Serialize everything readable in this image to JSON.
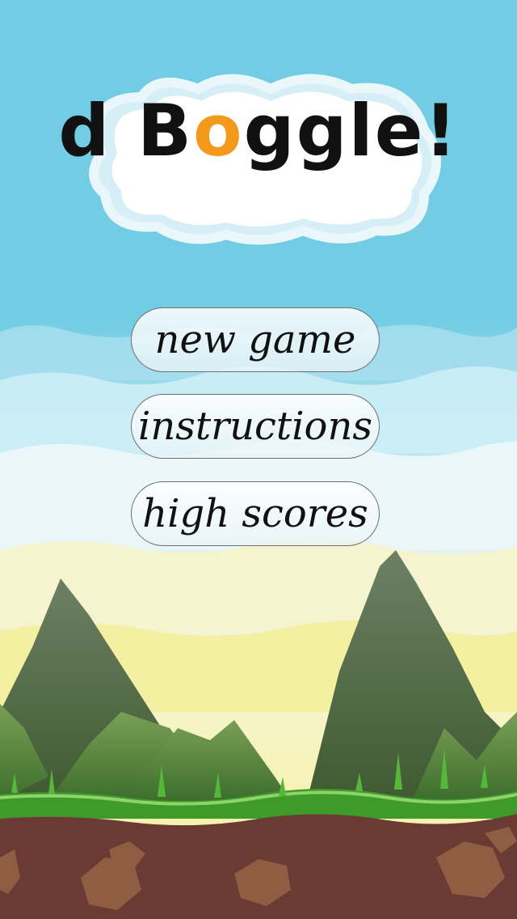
{
  "app": {
    "title_parts": [
      "d B",
      "o",
      "ggle!"
    ]
  },
  "menu": {
    "new_game": "new game",
    "instructions": "instructions",
    "high_scores": "high scores"
  },
  "colors": {
    "sky_top": "#72cde4",
    "sky_bottom": "#fbf4c8",
    "mountain": "#596d50",
    "grass": "#3e9a2a",
    "soil": "#6b3a33",
    "logo_accent": "#f39a1c"
  },
  "icons": [
    "mountain-icon",
    "grass-icon",
    "rock-icon"
  ]
}
